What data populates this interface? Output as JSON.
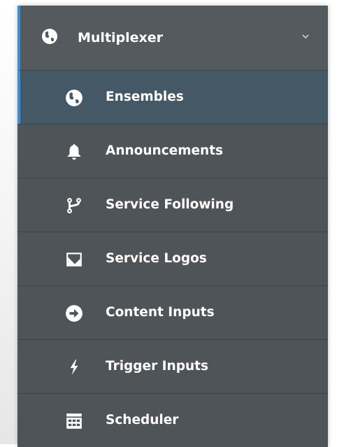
{
  "menu": {
    "header": {
      "label": "Multiplexer",
      "icon": "globe-icon",
      "chevron": "chevron-down-icon"
    },
    "items": [
      {
        "label": "Ensembles",
        "icon": "globe-icon",
        "active": true
      },
      {
        "label": "Announcements",
        "icon": "bell-icon",
        "active": false
      },
      {
        "label": "Service Following",
        "icon": "code-fork-icon",
        "active": false
      },
      {
        "label": "Service Logos",
        "icon": "image-icon",
        "active": false
      },
      {
        "label": "Content Inputs",
        "icon": "arrow-circle-right-icon",
        "active": false
      },
      {
        "label": "Trigger Inputs",
        "icon": "bolt-icon",
        "active": false
      },
      {
        "label": "Scheduler",
        "icon": "calendar-icon",
        "active": false
      }
    ]
  },
  "colors": {
    "sidebar_bg": "#4f5458",
    "header_bg": "#545a5e",
    "active_bg": "#445866",
    "accent": "#3e8ed0",
    "text": "#ffffff"
  }
}
